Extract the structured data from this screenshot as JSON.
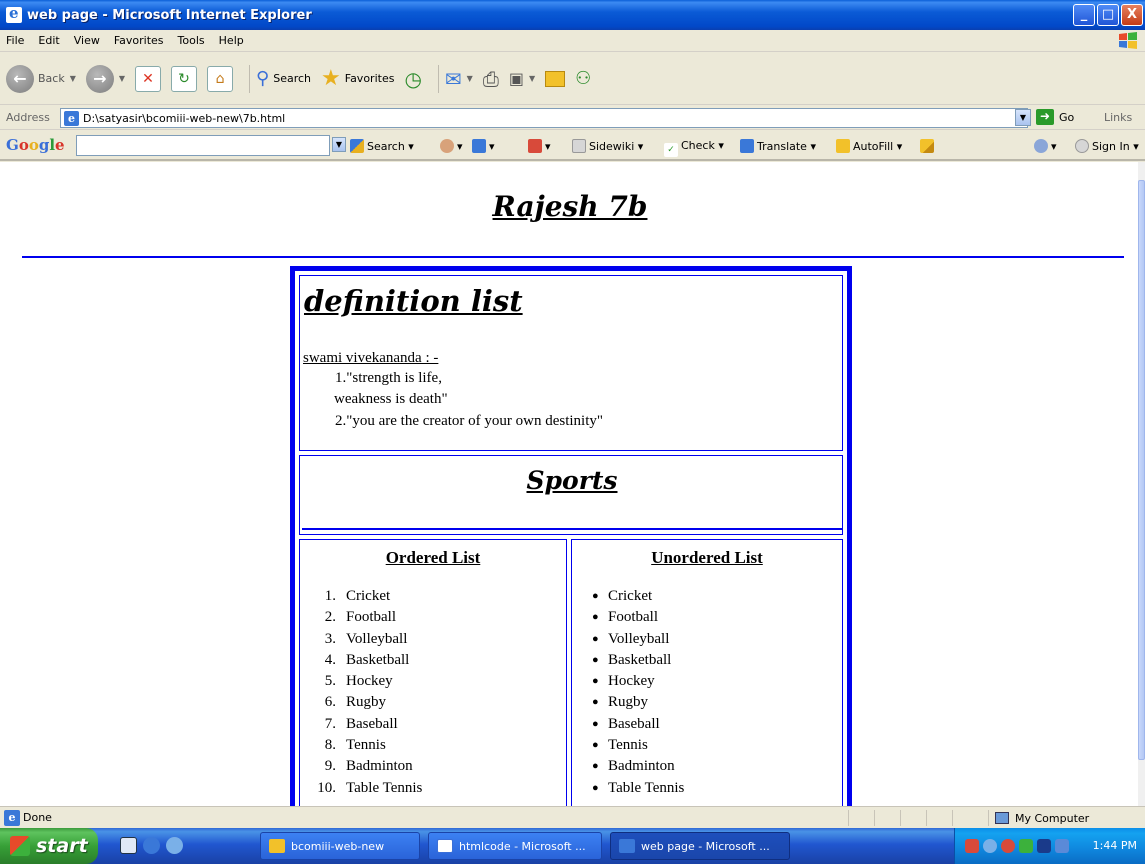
{
  "window": {
    "title": "web page - Microsoft Internet Explorer",
    "buttons": [
      "_",
      "□",
      "X"
    ]
  },
  "menu": [
    "File",
    "Edit",
    "View",
    "Favorites",
    "Tools",
    "Help"
  ],
  "toolbar": {
    "back_label": "Back",
    "search_label": "Search",
    "favorites_label": "Favorites"
  },
  "address": {
    "label": "Address",
    "value": "D:\\satyasir\\bcomiii-web-new\\7b.html",
    "go_label": "Go",
    "links_label": "Links"
  },
  "googlebar": {
    "logo": "Google",
    "search_label": "Search",
    "sidewiki_label": "Sidewiki",
    "check_label": "Check",
    "translate_label": "Translate",
    "autofill_label": "AutoFill",
    "signin_label": "Sign In"
  },
  "page": {
    "title": "Rajesh 7b",
    "definition": {
      "heading": "definition list",
      "term": "swami vivekananda : -",
      "lines": [
        "1.\"strength is life,",
        "weakness is death\"",
        "2.\"you are the creator of your own destinity\""
      ]
    },
    "sports": {
      "heading": "Sports",
      "ordered_heading": "Ordered List",
      "unordered_heading": "Unordered List",
      "items": [
        "Cricket",
        "Football",
        "Volleyball",
        "Basketball",
        "Hockey",
        "Rugby",
        "Baseball",
        "Tennis",
        "Badminton",
        "Table Tennis"
      ],
      "numbers": [
        "1.",
        "2.",
        "3.",
        "4.",
        "5.",
        "6.",
        "7.",
        "8.",
        "9.",
        "10."
      ]
    }
  },
  "status": {
    "text": "Done",
    "zone": "My Computer"
  },
  "taskbar": {
    "start_label": "start",
    "tasks": [
      "bcomiii-web-new",
      "htmlcode - Microsoft ...",
      "web page - Microsoft ..."
    ],
    "clock": "1:44 PM"
  }
}
